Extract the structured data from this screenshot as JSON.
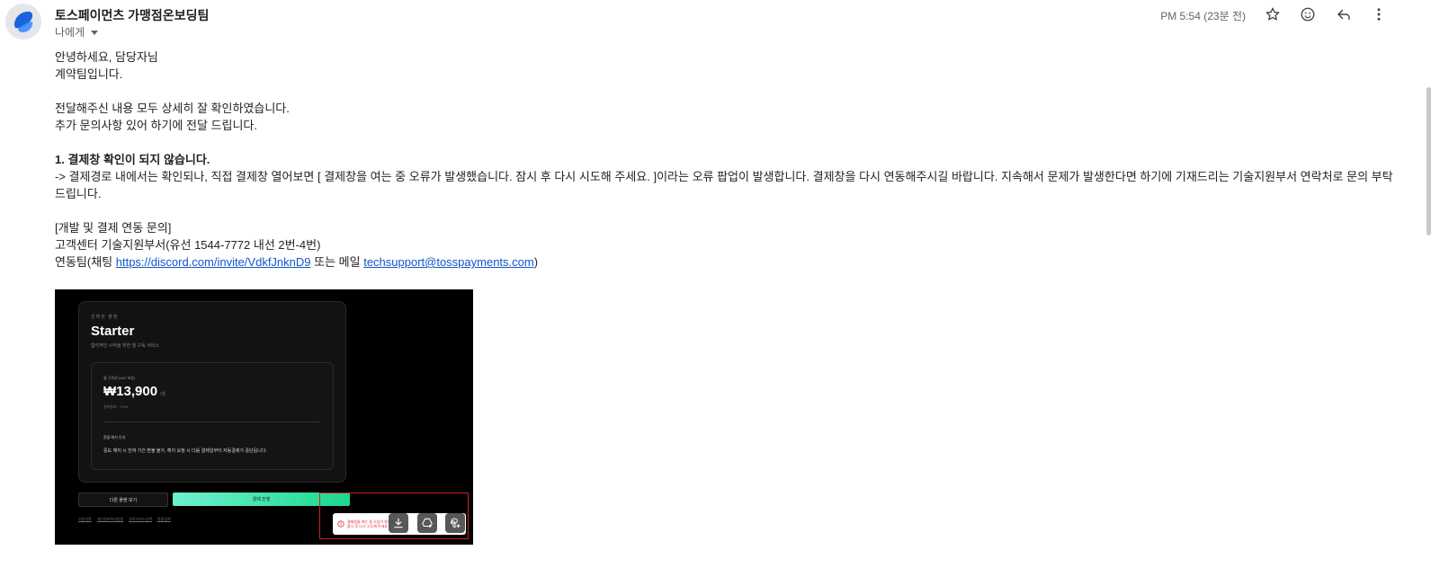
{
  "header": {
    "sender_name": "토스페이먼츠 가맹점온보딩팀",
    "recipient": "나에게",
    "time": "PM 5:54 (23분 전)"
  },
  "body": {
    "line1": "안녕하세요, 담당자님",
    "line2": "계약팀입니다.",
    "line3": "전달해주신 내용 모두 상세히 잘 확인하였습니다.",
    "line4": "추가 문의사항 있어 하기에 전달 드립니다.",
    "heading1": "1. 결제창 확인이 되지 않습니다.",
    "paragraph1": "-> 결제경로 내에서는 확인되나, 직접 결제창 열어보면 [ 결제창을 여는 중 오류가 발생했습니다. 잠시 후 다시 시도해 주세요. ]이라는 오류 팝업이 발생합니다. 결제창을 다시 연동해주시길 바랍니다. 지속해서 문제가 발생한다면 하기에 기재드리는 기술지원부서 연락처로 문의 부탁드립니다.",
    "contact_heading": "[개발 및 결제 연동 문의]",
    "contact_line1": "고객센터 기술지원부서(유선 1544-7772 내선 2번-4번)",
    "contact_line2_prefix": "연동팀(채팅 ",
    "discord_link": "https://discord.com/invite/VdkfJnknD9",
    "contact_line2_middle": " 또는 메일 ",
    "email_link": "techsupport@tosspayments.com",
    "contact_line2_suffix": ")"
  },
  "screenshot": {
    "selected_plan_label": "선택한 플랜",
    "plan_name": "Starter",
    "plan_desc": "합리적인 시작을 위한 월 구독 서비스",
    "price_label": "월 구독료 (VAT 포함)",
    "price": "₩13,900",
    "price_unit": "/월",
    "currency_note": "결제통화 · KRW",
    "refund_title": "환불/해지 안내",
    "refund_desc": "중도 해지 시 잔여 기간 환불 불가. 해지 요청 시 다음 결제일부터 자동결제가 중단됩니다.",
    "other_plan_button": "다른 플랜 보기",
    "pay_button": "결제 진행",
    "footer_links": [
      "이용약관",
      "개인정보처리방침",
      "유료서비스정책",
      "환불정책"
    ],
    "error_text_line1": "결제창을 여는 중 오류가 발생했습니다.",
    "error_text_line2": "잠시 후 다시 시도해 주세요."
  }
}
